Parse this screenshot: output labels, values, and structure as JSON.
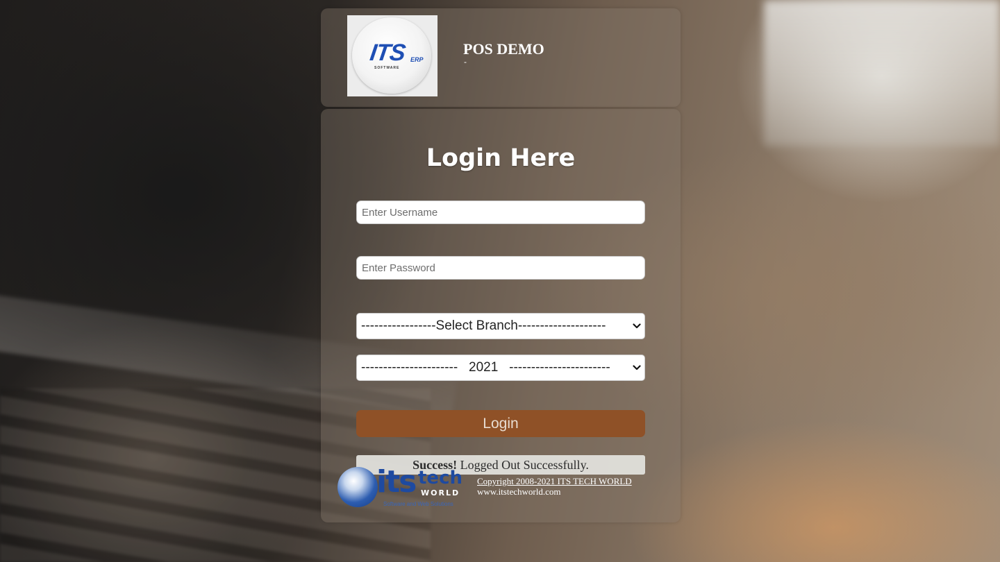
{
  "header": {
    "logo_text": "ITS",
    "logo_sub": "ERP",
    "logo_tag": "SOFTWARE",
    "company_name": "POS DEMO",
    "company_sub": "-"
  },
  "login": {
    "title": "Login Here",
    "username": {
      "placeholder": "Enter Username",
      "value": ""
    },
    "password": {
      "placeholder": "Enter Password",
      "value": ""
    },
    "branch_select": {
      "selected": "-----------------Select Branch--------------------"
    },
    "year_select": {
      "selected": "----------------------   2021   -----------------------"
    },
    "button_label": "Login"
  },
  "alert": {
    "strong": "Success!",
    "message": " Logged Out Successfully."
  },
  "footer": {
    "logo_its": "its",
    "logo_tech": "tech",
    "logo_world": "WORLD",
    "logo_tagline": "Software and Web Solutions",
    "copyright": "Copyright 2008-2021 ITS TECH WORLD",
    "website": "www.itstechworld.com"
  },
  "colors": {
    "login_button": "#8f5127",
    "logo_blue": "#1f4fb4"
  },
  "icons": [
    "chevron-down-icon"
  ]
}
